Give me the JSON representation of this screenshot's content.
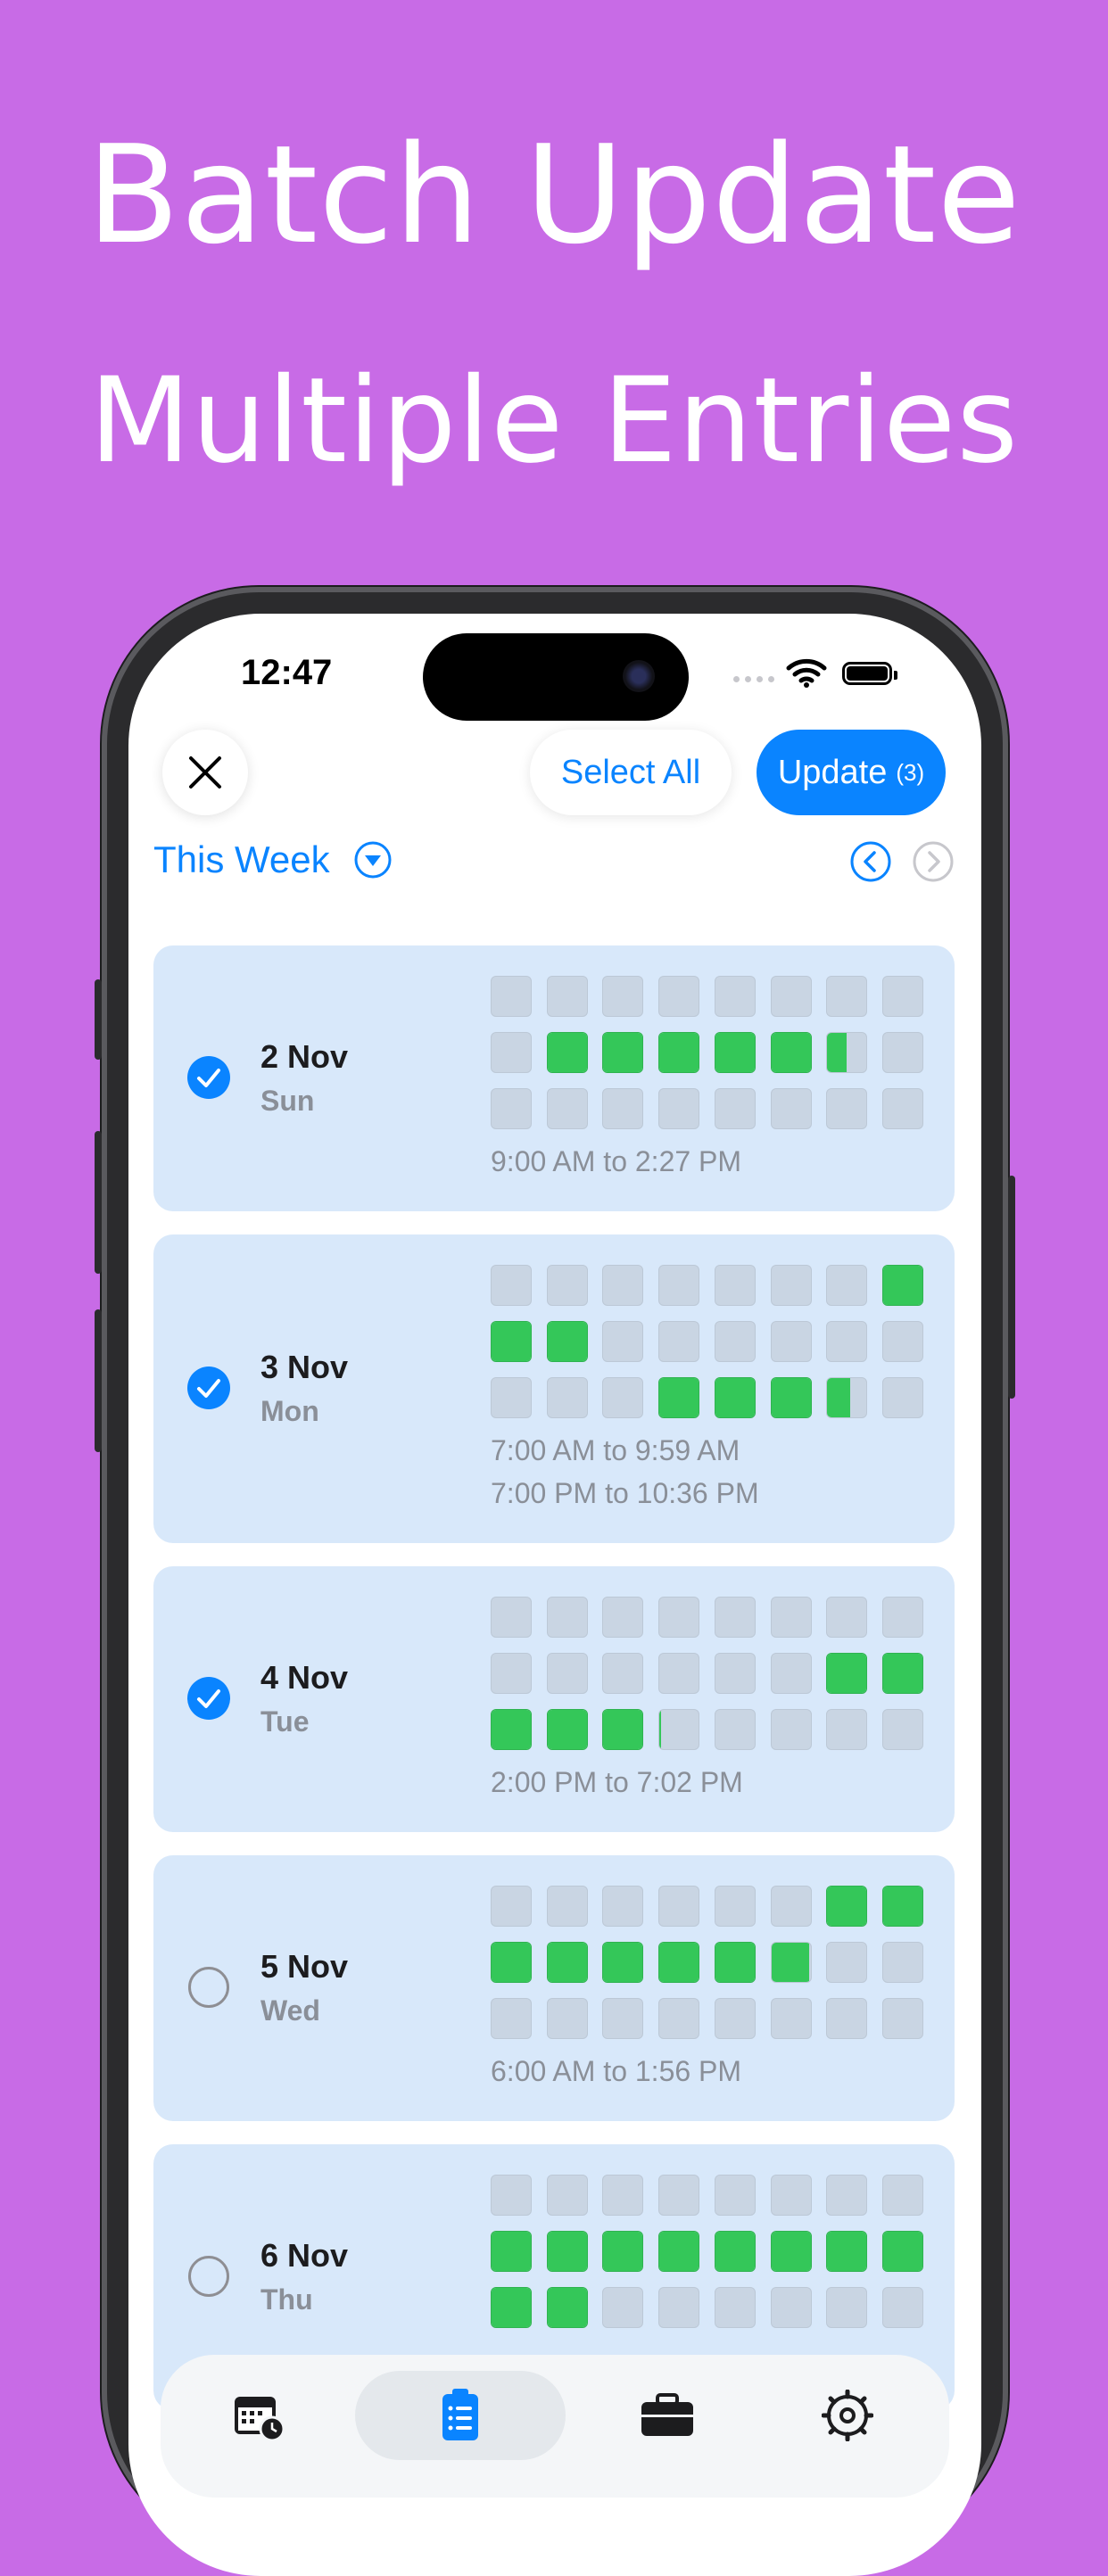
{
  "headline": {
    "line1": "Batch Update",
    "line2": "Multiple Entries"
  },
  "status_bar": {
    "time": "12:47"
  },
  "toolbar": {
    "select_all": "Select All",
    "update": "Update",
    "update_count": "(3)"
  },
  "week": {
    "label": "This Week"
  },
  "colors": {
    "accent": "#0a84ff",
    "filled": "#34c759",
    "empty": "#c9d5e3",
    "card": "#d8e8fa",
    "background": "#c86be6"
  },
  "days": [
    {
      "date": "2 Nov",
      "dow": "Sun",
      "selected": true,
      "rows": [
        [
          0,
          0,
          0,
          0,
          0,
          0,
          0,
          0
        ],
        [
          0,
          1,
          1,
          1,
          1,
          1,
          0.5,
          0
        ],
        [
          0,
          0,
          0,
          0,
          0,
          0,
          0,
          0
        ]
      ],
      "ranges": [
        "9:00 AM to 2:27 PM"
      ]
    },
    {
      "date": "3 Nov",
      "dow": "Mon",
      "selected": true,
      "rows": [
        [
          0,
          0,
          0,
          0,
          0,
          0,
          0,
          1
        ],
        [
          1,
          1,
          0,
          0,
          0,
          0,
          0,
          0
        ],
        [
          0,
          0,
          0,
          1,
          1,
          1,
          0.6,
          0
        ]
      ],
      "ranges": [
        "7:00 AM to 9:59 AM",
        "7:00 PM to 10:36 PM"
      ]
    },
    {
      "date": "4 Nov",
      "dow": "Tue",
      "selected": true,
      "rows": [
        [
          0,
          0,
          0,
          0,
          0,
          0,
          0,
          0
        ],
        [
          0,
          0,
          0,
          0,
          0,
          0,
          1,
          1
        ],
        [
          1,
          1,
          1,
          0.05,
          0,
          0,
          0,
          0
        ]
      ],
      "ranges": [
        "2:00 PM to 7:02 PM"
      ]
    },
    {
      "date": "5 Nov",
      "dow": "Wed",
      "selected": false,
      "rows": [
        [
          0,
          0,
          0,
          0,
          0,
          0,
          1,
          1
        ],
        [
          1,
          1,
          1,
          1,
          1,
          0.95,
          0,
          0
        ],
        [
          0,
          0,
          0,
          0,
          0,
          0,
          0,
          0
        ]
      ],
      "ranges": [
        "6:00 AM to 1:56 PM"
      ]
    },
    {
      "date": "6 Nov",
      "dow": "Thu",
      "selected": false,
      "rows": [
        [
          0,
          0,
          0,
          0,
          0,
          0,
          0,
          0
        ],
        [
          1,
          1,
          1,
          1,
          1,
          1,
          1,
          1
        ],
        [
          1,
          1,
          0,
          0,
          0,
          0,
          0,
          0
        ]
      ],
      "ranges": []
    }
  ],
  "tabs": [
    {
      "icon": "calendar-clock-icon",
      "active": false
    },
    {
      "icon": "checklist-icon",
      "active": true
    },
    {
      "icon": "briefcase-icon",
      "active": false
    },
    {
      "icon": "gear-icon",
      "active": false
    }
  ]
}
